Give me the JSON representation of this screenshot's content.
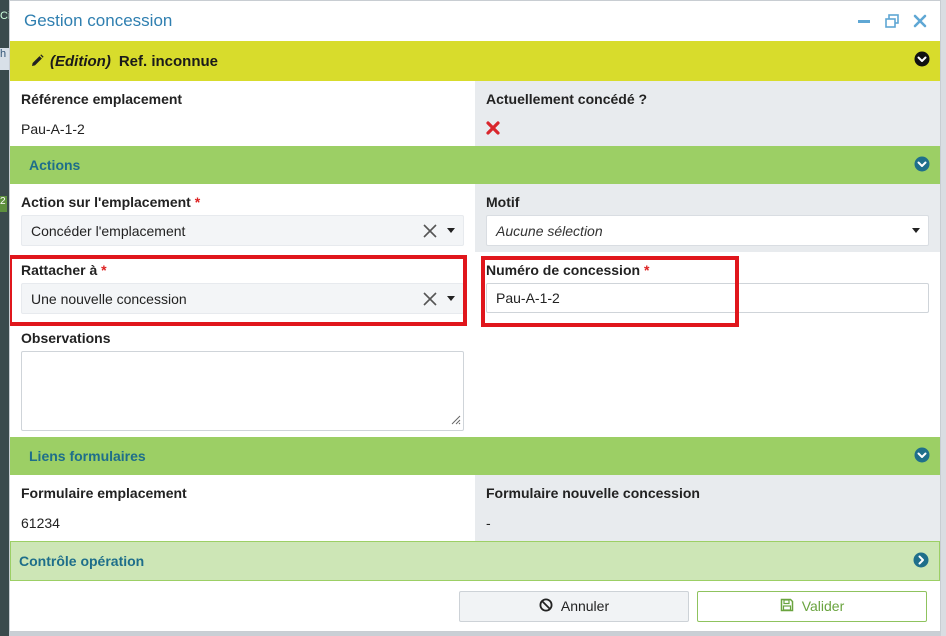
{
  "window": {
    "title": "Gestion concession"
  },
  "header": {
    "edition": "(Edition)",
    "ref": "Ref. inconnue"
  },
  "info": {
    "ref_label": "Référence emplacement",
    "ref_value": "Pau-A-1-2",
    "concede_label": "Actuellement concédé ?"
  },
  "actions": {
    "section_title": "Actions",
    "action_label": "Action sur l'emplacement",
    "action_value": "Concéder l'emplacement",
    "motif_label": "Motif",
    "motif_value": "Aucune sélection",
    "rattacher_label": "Rattacher à",
    "rattacher_value": "Une nouvelle concession",
    "numero_label": "Numéro de concession",
    "numero_value": "Pau-A-1-2",
    "observations_label": "Observations",
    "required_mark": "*"
  },
  "liens": {
    "section_title": "Liens formulaires",
    "form_empl_label": "Formulaire emplacement",
    "form_empl_value": "61234",
    "form_conc_label": "Formulaire nouvelle concession",
    "form_conc_value": "-"
  },
  "controle": {
    "section_title": "Contrôle opération"
  },
  "footer": {
    "cancel_label": "Annuler",
    "ok_label": "Valider"
  },
  "colors": {
    "accent_yellow": "#d8dc2c",
    "accent_green": "#9ccf65",
    "title_blue": "#2f7fb0",
    "highlight_red": "#e0161c"
  }
}
